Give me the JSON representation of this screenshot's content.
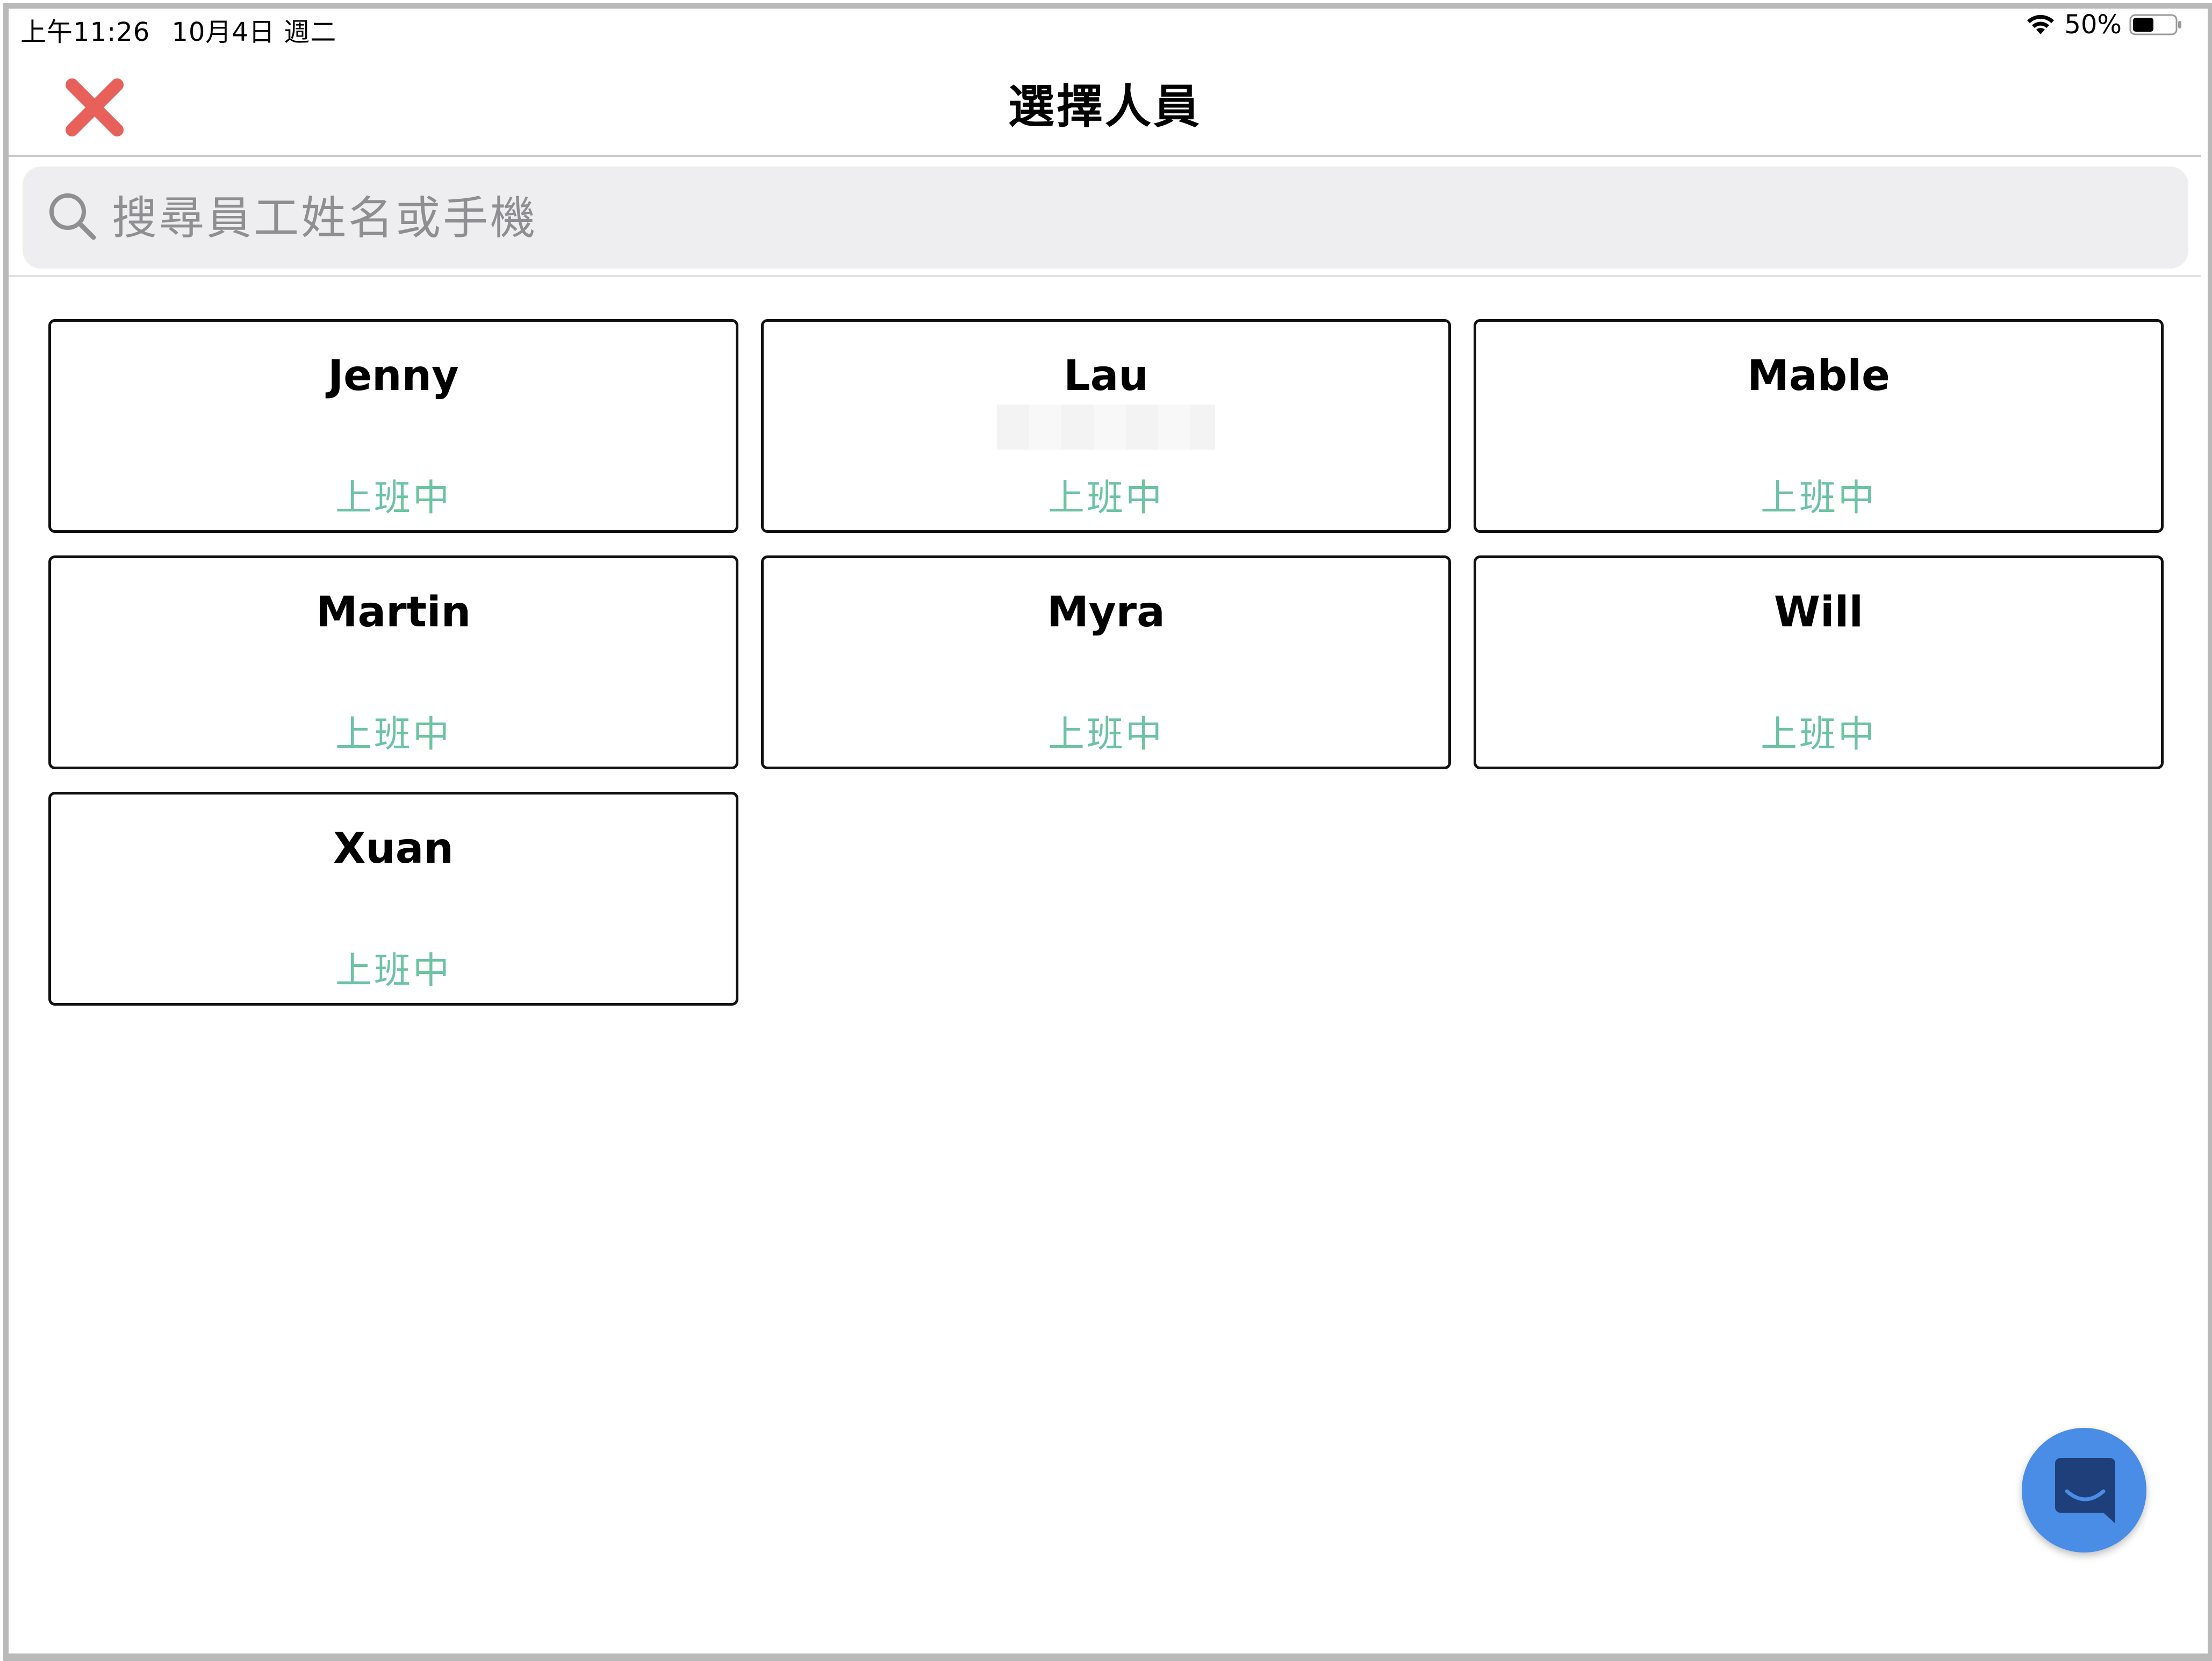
{
  "status_bar": {
    "time": "上午11:26",
    "date": "10月4日 週二",
    "battery_percent": "50%",
    "battery_level": 0.5
  },
  "nav": {
    "title": "選擇人員",
    "close_icon": "close-x-icon",
    "close_color": "#e8605a"
  },
  "search": {
    "placeholder": "搜尋員工姓名或手機",
    "value": "",
    "icon": "search-icon"
  },
  "staff": [
    {
      "name": "Jenny",
      "status": "上班中"
    },
    {
      "name": "Lau",
      "status": "上班中"
    },
    {
      "name": "Mable",
      "status": "上班中"
    },
    {
      "name": "Martin",
      "status": "上班中"
    },
    {
      "name": "Myra",
      "status": "上班中"
    },
    {
      "name": "Will",
      "status": "上班中"
    },
    {
      "name": "Xuan",
      "status": "上班中"
    }
  ],
  "colors": {
    "status_green": "#6cc3a3",
    "fab_blue": "#4a8de6",
    "search_bg": "#eeeef0"
  },
  "fab": {
    "icon": "chat-icon"
  }
}
